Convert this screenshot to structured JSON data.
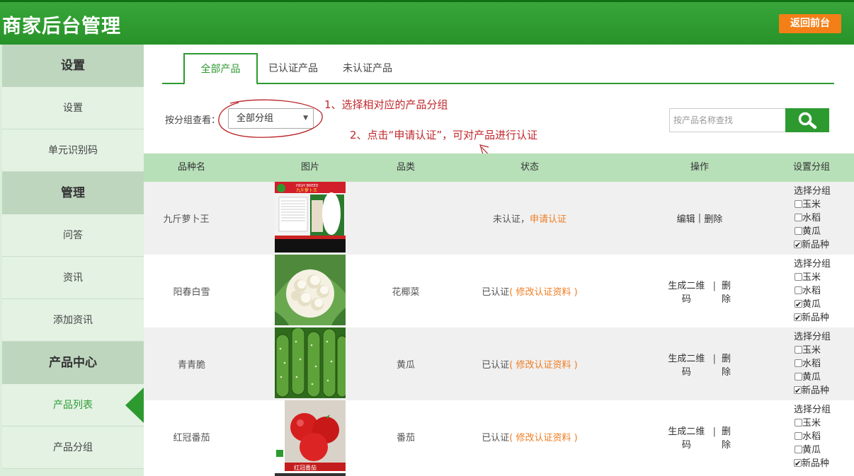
{
  "header": {
    "title": "商家后台管理",
    "back_label": "返回前台"
  },
  "sidebar": {
    "settings_section": "设置",
    "settings_item": "设置",
    "unit_code_item": "单元识别码",
    "manage_section": "管理",
    "qa_item": "问答",
    "news_item": "资讯",
    "add_news_item": "添加资讯",
    "product_section": "产品中心",
    "product_list_item": "产品列表",
    "product_group_item": "产品分组"
  },
  "tabs": {
    "all": "全部产品",
    "certified": "已认证产品",
    "uncertified": "未认证产品"
  },
  "filter": {
    "label": "按分组查看：",
    "selected": "全部分组"
  },
  "annotations": {
    "step1": "1、选择相对应的产品分组",
    "step2": "2、点击“申请认证”，可对产品进行认证"
  },
  "search": {
    "placeholder": "按产品名称查找"
  },
  "table": {
    "headers": {
      "name": "品种名",
      "image": "图片",
      "category": "品类",
      "status": "状态",
      "action": "操作",
      "group": "设置分组"
    },
    "rows": [
      {
        "name": "九斤萝卜王",
        "category": "",
        "status": "未认证，",
        "status_link": "申请认证",
        "op1": "编辑",
        "op2": "删除",
        "group_title": "选择分组",
        "opt1": "玉米",
        "opt2": "水稻",
        "opt3": "黄瓜",
        "opt4": "新品种",
        "checked": [
          false,
          false,
          false,
          true
        ]
      },
      {
        "name": "阳春白雪",
        "category": "花椰菜",
        "status": "已认证",
        "status_link": "( 修改认证资料 )",
        "op1": "生成二维码",
        "op2": "删除",
        "group_title": "选择分组",
        "opt1": "玉米",
        "opt2": "水稻",
        "opt3": "黄瓜",
        "opt4": "新品种",
        "checked": [
          false,
          false,
          true,
          true
        ]
      },
      {
        "name": "青青脆",
        "category": "黄瓜",
        "status": "已认证",
        "status_link": "( 修改认证资料 )",
        "op1": "生成二维码",
        "op2": "删除",
        "group_title": "选择分组",
        "opt1": "玉米",
        "opt2": "水稻",
        "opt3": "黄瓜",
        "opt4": "新品种",
        "checked": [
          false,
          false,
          false,
          true
        ]
      },
      {
        "name": "红冠番茄",
        "category": "番茄",
        "status": "已认证",
        "status_link": "( 修改认证资料 )",
        "op1": "生成二维码",
        "op2": "删除",
        "group_title": "选择分组",
        "opt1": "玉米",
        "opt2": "水稻",
        "opt3": "黄瓜",
        "opt4": "新品种",
        "checked": [
          false,
          false,
          false,
          true
        ]
      }
    ]
  },
  "image_labels": {
    "seed_pack_top": "HIGH BREED",
    "seed_pack_name": "九斤萝卜王",
    "tomato_pack_name": "红冠番茄"
  },
  "colors": {
    "header_green": "#2d9a30",
    "accent_orange": "#f47f16",
    "annotation_red": "#c0282d",
    "table_head": "#b7e0b8"
  }
}
